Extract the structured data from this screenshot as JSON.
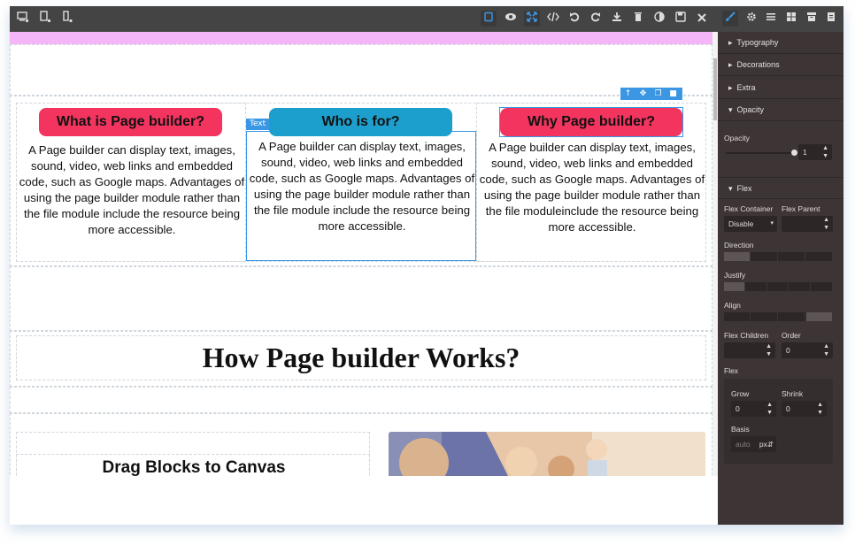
{
  "toolbar": {
    "left_icons": [
      "desktop-icon",
      "tablet-icon",
      "mobile-icon"
    ],
    "center_icons": [
      "outline-icon",
      "preview-icon",
      "fullscreen-icon",
      "code-icon",
      "undo-icon",
      "redo-icon",
      "import-icon",
      "trash-icon",
      "contrast-icon",
      "save-icon",
      "close-icon"
    ],
    "right_icons": [
      "brush-icon",
      "gear-icon",
      "layers-icon",
      "blocks-icon",
      "archive-icon",
      "file-icon"
    ]
  },
  "columns": [
    {
      "title": "What is Page builder?",
      "color": "#f2345f",
      "text": "A Page builder can display text, images, sound, video, web links and embedded code, such as Google maps. Advantages of using the page builder module rather than the file module include the resource being more accessible."
    },
    {
      "title": "Who is for?",
      "color": "#1d9fcd",
      "text": "A Page builder can display text, images, sound, video, web links and embedded code, such as Google maps. Advantages of using the page builder module rather than the file module include the resource being more accessible."
    },
    {
      "title": "Why Page builder?",
      "color": "#f2345f",
      "text": "A Page builder can display text, images, sound, video, web links and embedded code, such as Google maps. Advantages of using the page builder module rather than the file moduleinclude the resource being more accessible."
    }
  ],
  "selected_badge": "Text",
  "heading": "How Page builder Works?",
  "drag_title": "Drag Blocks to Canvas",
  "panel": {
    "sections": {
      "typography": "Typography",
      "decorations": "Decorations",
      "extra": "Extra",
      "opacity": "Opacity",
      "flex": "Flex"
    },
    "opacity_label": "Opacity",
    "opacity_value": "1",
    "opacity_level": 1.0,
    "flex_container_label": "Flex Container",
    "flex_parent_label": "Flex Parent",
    "flex_container_value": "Disable",
    "direction_label": "Direction",
    "justify_label": "Justify",
    "align_label": "Align",
    "flex_children_label": "Flex Children",
    "order_label": "Order",
    "order_value": "0",
    "flex_label": "Flex",
    "grow_label": "Grow",
    "shrink_label": "Shrink",
    "grow_value": "0",
    "shrink_value": "0",
    "basis_label": "Basis",
    "basis_placeholder": "auto",
    "basis_unit": "px"
  },
  "colors": {
    "accent": "#3b97e3",
    "panel_bg": "#3d3535",
    "topbar_bg": "#444444",
    "pink_strip": "#f4b6f6"
  }
}
